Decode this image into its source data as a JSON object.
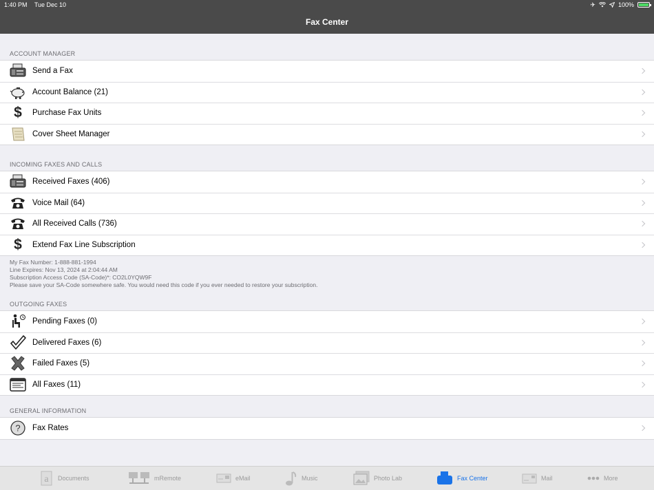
{
  "status_bar": {
    "time": "1:40 PM",
    "date": "Tue Dec 10",
    "battery": "100%"
  },
  "nav": {
    "title": "Fax Center"
  },
  "sections": {
    "account_manager": {
      "header": "ACCOUNT MANAGER",
      "items": [
        {
          "label": "Send a Fax",
          "icon": "fax-machine-icon"
        },
        {
          "label": "Account Balance (21)",
          "icon": "piggy-bank-icon"
        },
        {
          "label": "Purchase Fax Units",
          "icon": "dollar-icon"
        },
        {
          "label": "Cover Sheet Manager",
          "icon": "scroll-icon"
        }
      ]
    },
    "incoming": {
      "header": "INCOMING FAXES AND CALLS",
      "items": [
        {
          "label": "Received Faxes (406)",
          "icon": "fax-machine-icon"
        },
        {
          "label": "Voice Mail (64)",
          "icon": "telephone-icon"
        },
        {
          "label": "All Received Calls (736)",
          "icon": "telephone-icon"
        },
        {
          "label": "Extend Fax Line Subscription",
          "icon": "dollar-icon"
        }
      ],
      "footer": [
        "My Fax Number: 1-888-881-1994",
        "Line Expires: Nov 13, 2024 at 2:04:44 AM",
        "Subscription Access Code (SA-Code)*: CO2L0YQW9F",
        "Please save your SA-Code somewhere safe.  You would need this code if you ever needed to restore your subscription."
      ]
    },
    "outgoing": {
      "header": "OUTGOING FAXES",
      "items": [
        {
          "label": "Pending Faxes (0)",
          "icon": "waiting-person-icon"
        },
        {
          "label": "Delivered Faxes (6)",
          "icon": "checkmark-icon"
        },
        {
          "label": "Failed Faxes (5)",
          "icon": "x-mark-icon"
        },
        {
          "label": "All Faxes (11)",
          "icon": "fax-list-icon"
        }
      ]
    },
    "general": {
      "header": "GENERAL INFORMATION",
      "items": [
        {
          "label": "Fax Rates",
          "icon": "question-icon"
        }
      ]
    }
  },
  "tabs": [
    {
      "label": "Documents",
      "icon": "documents-icon"
    },
    {
      "label": "mRemote",
      "icon": "network-icon"
    },
    {
      "label": "eMail",
      "icon": "email-icon"
    },
    {
      "label": "Music",
      "icon": "music-note-icon"
    },
    {
      "label": "Photo Lab",
      "icon": "photos-icon"
    },
    {
      "label": "Fax Center",
      "icon": "fax-center-icon",
      "active": true
    },
    {
      "label": "Mail",
      "icon": "mail-icon"
    },
    {
      "label": "More",
      "icon": "more-dots-icon"
    }
  ],
  "colors": {
    "bar": "#4a4a4a",
    "active_tab": "#1a73e8",
    "battery": "#4cd964"
  }
}
